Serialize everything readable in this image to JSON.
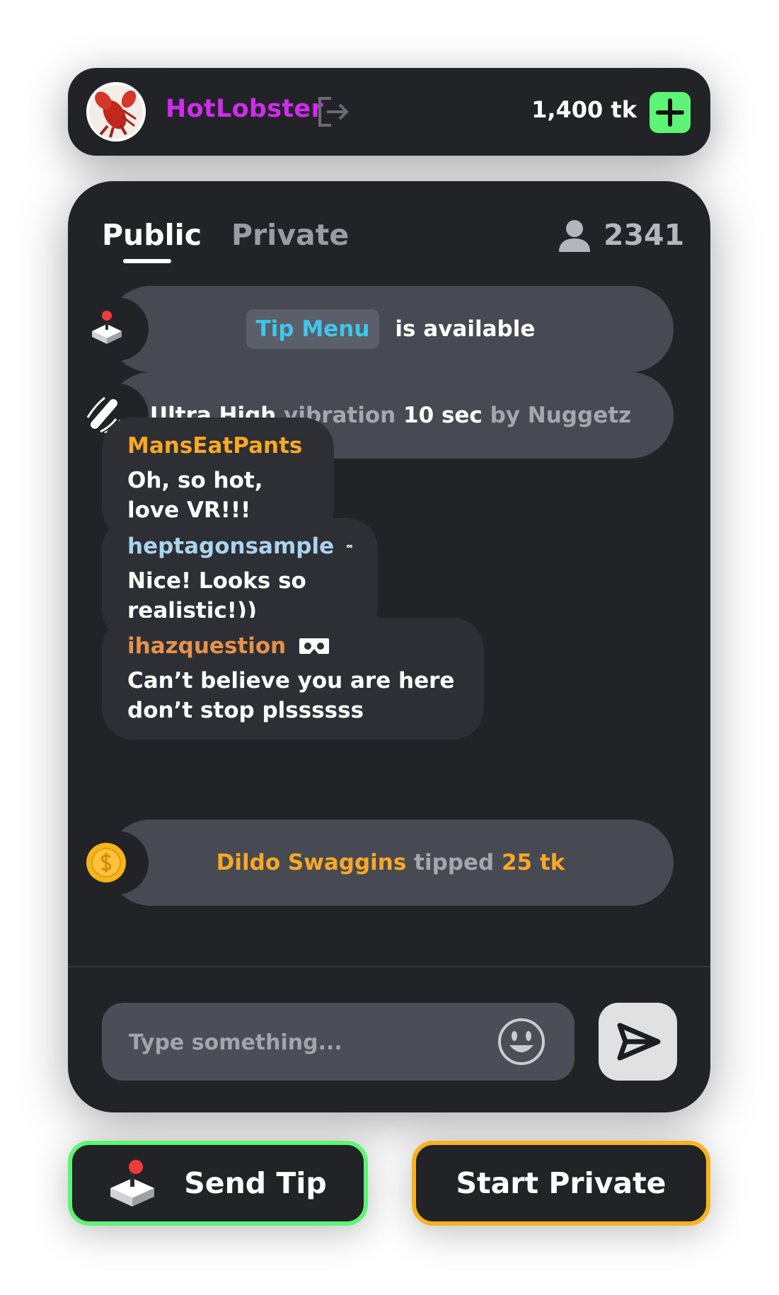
{
  "user": {
    "name": "HotLobster",
    "balance": "1,400 tk",
    "name_color": "#d12bef",
    "avatar_icon": "lobster-avatar",
    "logout_icon": "logout-icon",
    "add_icon": "plus-icon"
  },
  "chat": {
    "tabs": [
      {
        "label": "Public",
        "active": true
      },
      {
        "label": "Private",
        "active": false
      }
    ],
    "viewers": "2341",
    "messages": [
      {
        "type": "system",
        "icon": "joystick-icon",
        "chip": "Tip Menu",
        "text": "is available"
      },
      {
        "type": "system",
        "icon": "vibrator-icon",
        "parts": [
          "Ultra High",
          " vibration ",
          "10 sec",
          " by Nuggetz"
        ]
      },
      {
        "type": "user",
        "name": "MansEatPants",
        "name_color": "#f7a825",
        "text": "Oh, so hot, love VR!!!",
        "vr": false
      },
      {
        "type": "user",
        "name": "heptagonsample",
        "name_color": "#a9d4ef",
        "text": "Nice! Looks so realistic!))",
        "vr": true
      },
      {
        "type": "user",
        "name": "ihazquestion",
        "name_color": "#e6914d",
        "text": "Can’t believe you are here don’t stop plssssss",
        "vr": true
      },
      {
        "type": "tip",
        "icon": "coin-icon",
        "parts": [
          "Dildo Swaggins",
          " tipped ",
          "25 tk"
        ]
      }
    ],
    "input_placeholder": "Type something...",
    "emoji_icon": "smiley-icon",
    "send_icon": "send-icon"
  },
  "actions": {
    "send_tip": "Send Tip",
    "start_private": "Start Private"
  },
  "colors": {
    "background": "#222326",
    "accent_green": "#5ef476",
    "accent_gold": "#f7b21d",
    "tip_menu": "#3fc6ec"
  }
}
